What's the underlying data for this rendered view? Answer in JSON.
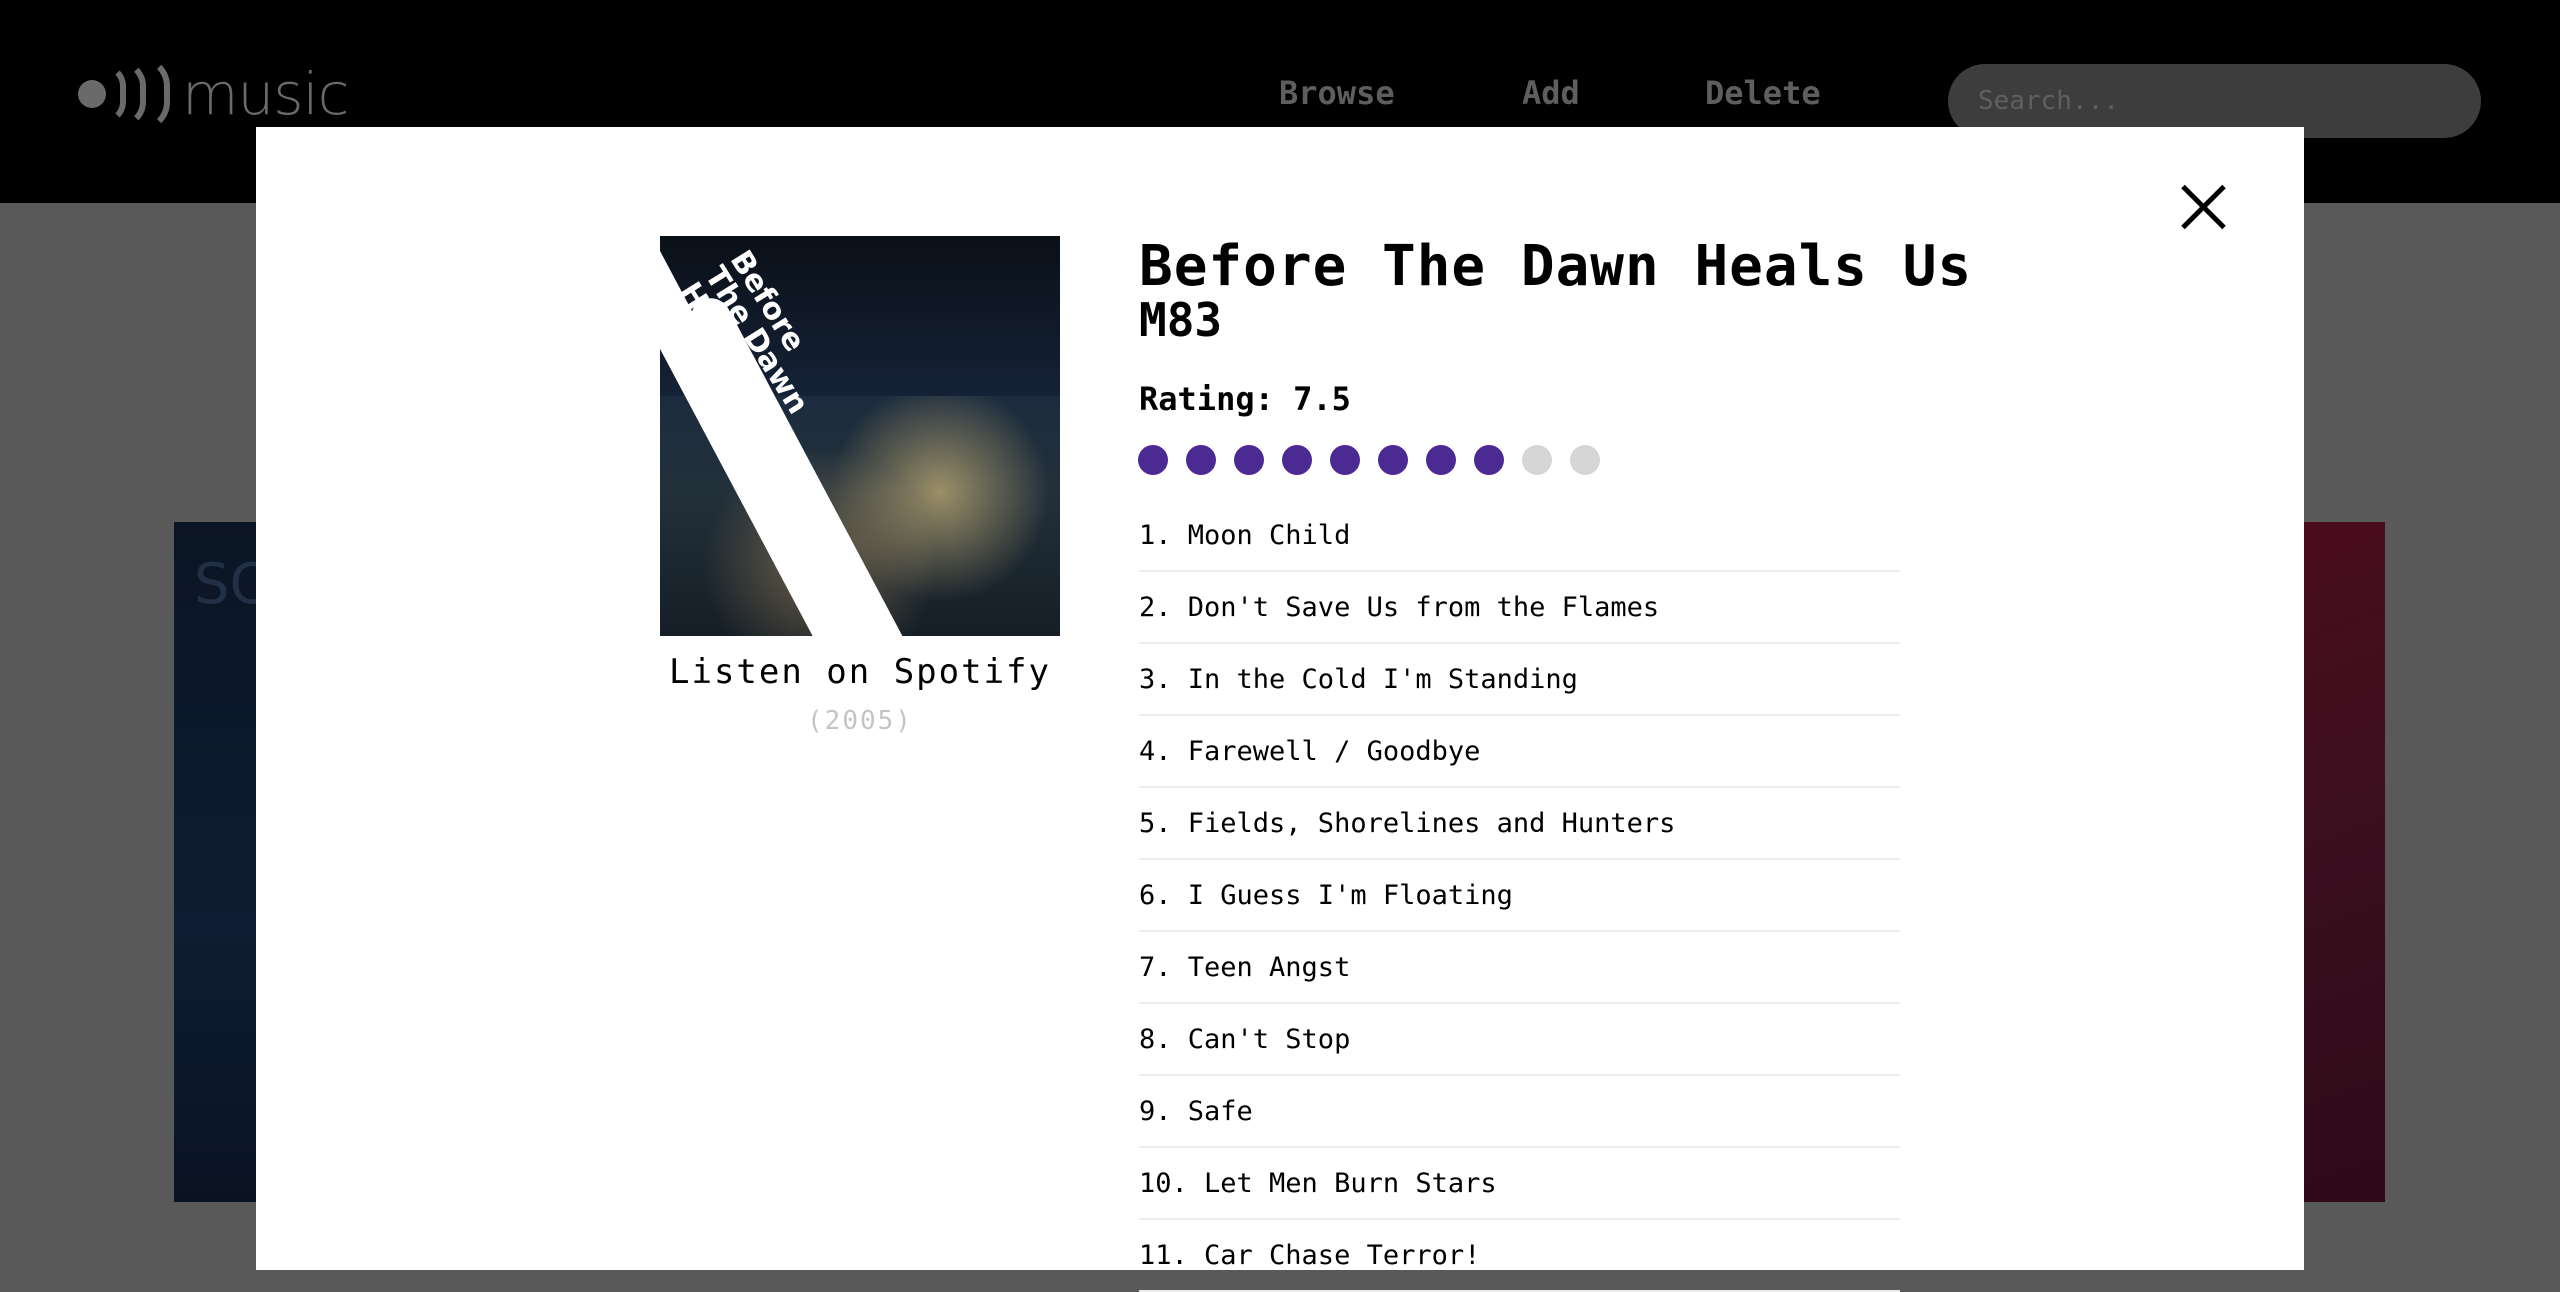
{
  "header": {
    "logo_text": "music",
    "nav": {
      "browse": "Browse",
      "add": "Add",
      "delete": "Delete"
    },
    "search_placeholder": "Search..."
  },
  "background_cards": {
    "left_text": "SC"
  },
  "modal": {
    "album_title": "Before The Dawn Heals Us",
    "artist": "M83",
    "rating_label": "Rating: 7.5",
    "rating_value": 7.5,
    "rating_max": 10,
    "rating_color": "#4b2a93",
    "spotify_label": "Listen on Spotify",
    "year": "(2005)",
    "cover_text": "Before\nThe Dawn\nHeals Us",
    "tracks": [
      "1. Moon Child",
      "2. Don't Save Us from the Flames",
      "3. In the Cold I'm Standing",
      "4. Farewell / Goodbye",
      "5. Fields, Shorelines and Hunters",
      "6. I Guess I'm Floating",
      "7. Teen Angst",
      "8. Can't Stop",
      "9. Safe",
      "10. Let Men Burn Stars",
      "11. Car Chase Terror!"
    ]
  }
}
